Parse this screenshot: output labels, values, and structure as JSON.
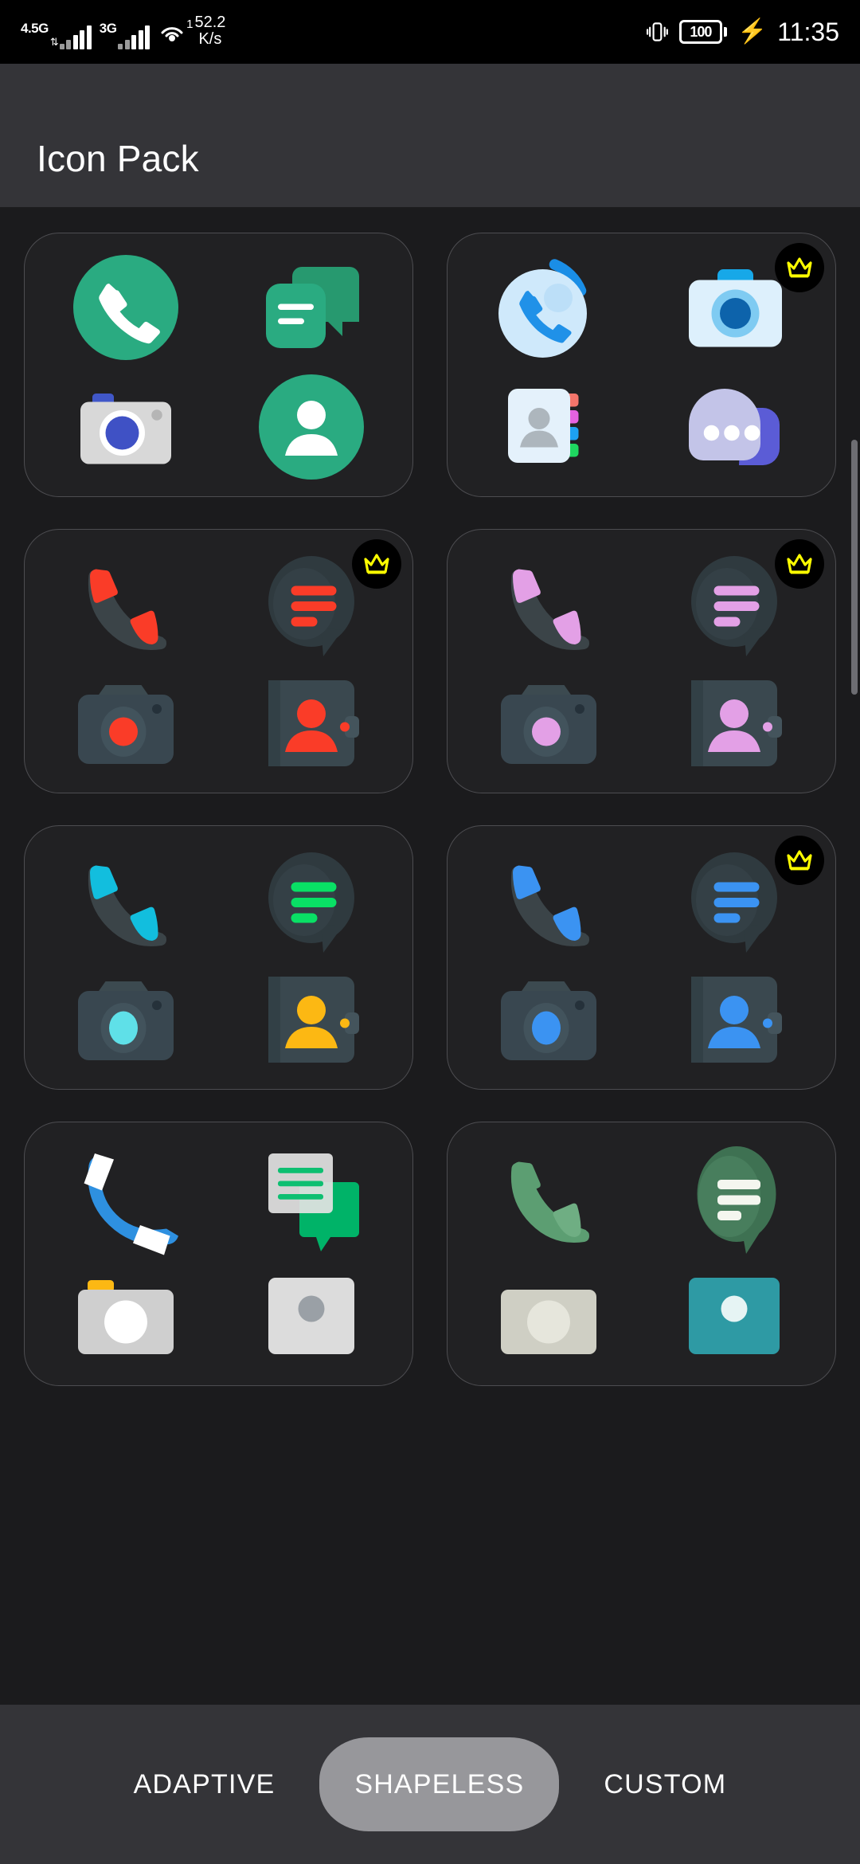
{
  "statusbar": {
    "network_primary": "4.5G",
    "network_secondary": "3G",
    "hotspot_badge": "1",
    "speed_value": "52.2",
    "speed_unit": "K/s",
    "battery_level": "100",
    "time": "11:35",
    "icons": [
      "signal-bars-icon",
      "hotspot-icon",
      "vibrate-icon",
      "battery-icon",
      "charging-bolt-icon"
    ]
  },
  "appbar": {
    "title": "Icon Pack"
  },
  "tabs": {
    "items": [
      {
        "label": "ADAPTIVE",
        "active": false
      },
      {
        "label": "SHAPELESS",
        "active": true
      },
      {
        "label": "CUSTOM",
        "active": false
      }
    ]
  },
  "colors": {
    "page_background": "#1b1b1d",
    "appbar_background": "#343438",
    "card_background": "#212123",
    "card_border": "#4d4d51",
    "tabbar_background": "#343438",
    "tab_active_pill": "#97979b",
    "crown_badge_background": "#000000",
    "crown_badge_color": "#ffff00",
    "accent_green": "#2aab81",
    "accent_blue": "#1a8ee6",
    "accent_red": "#fa3c28",
    "accent_pink": "#e3a0e6",
    "accent_cyan": "#12bede",
    "accent_azure": "#3b93f2",
    "accent_yellow": "#fcb813",
    "accent_spring": "#09e065",
    "accent_sage": "#5c9e72"
  },
  "cards": [
    {
      "name": "pixel-stock-pack",
      "premium": false,
      "icons": [
        "phone-icon",
        "messages-icon",
        "camera-icon",
        "contacts-icon"
      ]
    },
    {
      "name": "frosted-glass-pack",
      "premium": true,
      "icons": [
        "phone-icon",
        "camera-icon",
        "contacts-icon",
        "messages-icon"
      ]
    },
    {
      "name": "dark-red-pack",
      "premium": true,
      "icons": [
        "phone-icon",
        "messages-icon",
        "camera-icon",
        "contacts-icon"
      ]
    },
    {
      "name": "dark-pink-pack",
      "premium": true,
      "icons": [
        "phone-icon",
        "messages-icon",
        "camera-icon",
        "contacts-icon"
      ]
    },
    {
      "name": "dark-cyan-pack",
      "premium": false,
      "icons": [
        "phone-icon",
        "messages-icon",
        "camera-icon",
        "contacts-icon"
      ]
    },
    {
      "name": "dark-blue-pack",
      "premium": true,
      "icons": [
        "phone-icon",
        "messages-icon",
        "camera-icon",
        "contacts-icon"
      ]
    },
    {
      "name": "paper-blue-pack",
      "premium": false,
      "icons": [
        "phone-icon",
        "messages-icon",
        "camera-icon",
        "contacts-icon"
      ]
    },
    {
      "name": "sage-green-pack",
      "premium": false,
      "icons": [
        "phone-icon",
        "messages-icon",
        "camera-icon",
        "contacts-icon"
      ]
    }
  ]
}
